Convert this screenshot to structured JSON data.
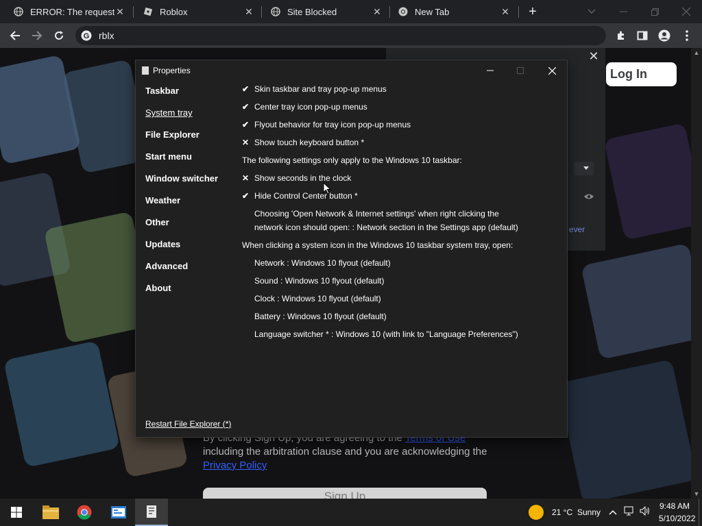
{
  "browser": {
    "tabs": [
      {
        "title": "ERROR: The requested",
        "favicon": "globe-icon",
        "active": false
      },
      {
        "title": "Roblox",
        "favicon": "roblox-icon",
        "active": false
      },
      {
        "title": "Site Blocked",
        "favicon": "globe-icon",
        "active": false
      },
      {
        "title": "New Tab",
        "favicon": "chrome-icon",
        "active": true
      }
    ],
    "new_tab_glyph": "+",
    "address": "rblx"
  },
  "roblox": {
    "login_label": "Log In",
    "close_glyph": "✕",
    "never_label": "ever",
    "legal_prefix": "By clicking Sign Up, you are agreeing to the",
    "terms_link": "Terms of Use",
    "legal_mid": "including the arbitration clause and you are acknowledging the",
    "privacy_link": "Privacy Policy",
    "signup_label": "Sign Up"
  },
  "properties": {
    "title": "Properties",
    "nav": [
      {
        "label": "Taskbar",
        "selected": false
      },
      {
        "label": "System tray",
        "selected": true
      },
      {
        "label": "File Explorer",
        "selected": false
      },
      {
        "label": "Start menu",
        "selected": false
      },
      {
        "label": "Window switcher",
        "selected": false
      },
      {
        "label": "Weather",
        "selected": false
      },
      {
        "label": "Other",
        "selected": false
      },
      {
        "label": "Updates",
        "selected": false
      },
      {
        "label": "Advanced",
        "selected": false
      },
      {
        "label": "About",
        "selected": false
      }
    ],
    "options": [
      {
        "mark": "✔",
        "text": "Skin taskbar and tray pop-up menus"
      },
      {
        "mark": "✔",
        "text": "Center tray icon pop-up menus"
      },
      {
        "mark": "✔",
        "text": "Flyout behavior for tray icon pop-up menus"
      },
      {
        "mark": "✕",
        "text": "Show touch keyboard button *"
      },
      {
        "mark": "",
        "text": "The following settings only apply to the Windows 10 taskbar:"
      },
      {
        "mark": "✕",
        "text": "Show seconds in the clock"
      },
      {
        "mark": "✔",
        "text": "Hide Control Center button *"
      },
      {
        "mark": "",
        "text": "Choosing 'Open Network & Internet settings' when right clicking the"
      },
      {
        "mark": "",
        "text": "network icon should open: : Network section in the Settings app (default)"
      },
      {
        "mark": "",
        "text": "When clicking a system icon in the Windows 10 taskbar system tray, open:"
      },
      {
        "mark": "",
        "text": "Network : Windows 10 flyout (default)"
      },
      {
        "mark": "",
        "text": "Sound : Windows 10 flyout (default)"
      },
      {
        "mark": "",
        "text": "Clock : Windows 10 flyout (default)"
      },
      {
        "mark": "",
        "text": "Battery : Windows 10 flyout (default)"
      },
      {
        "mark": "",
        "text": "Language switcher * : Windows 10 (with link to \"Language Preferences\")"
      }
    ],
    "restart_label": "Restart File Explorer (*)"
  },
  "taskbar": {
    "weather_temp": "21 °C",
    "weather_desc": "Sunny",
    "time": "9:48 AM",
    "date": "5/10/2022",
    "colors": {
      "accent": "#9ab7d8",
      "sun": "#f5b400"
    }
  }
}
